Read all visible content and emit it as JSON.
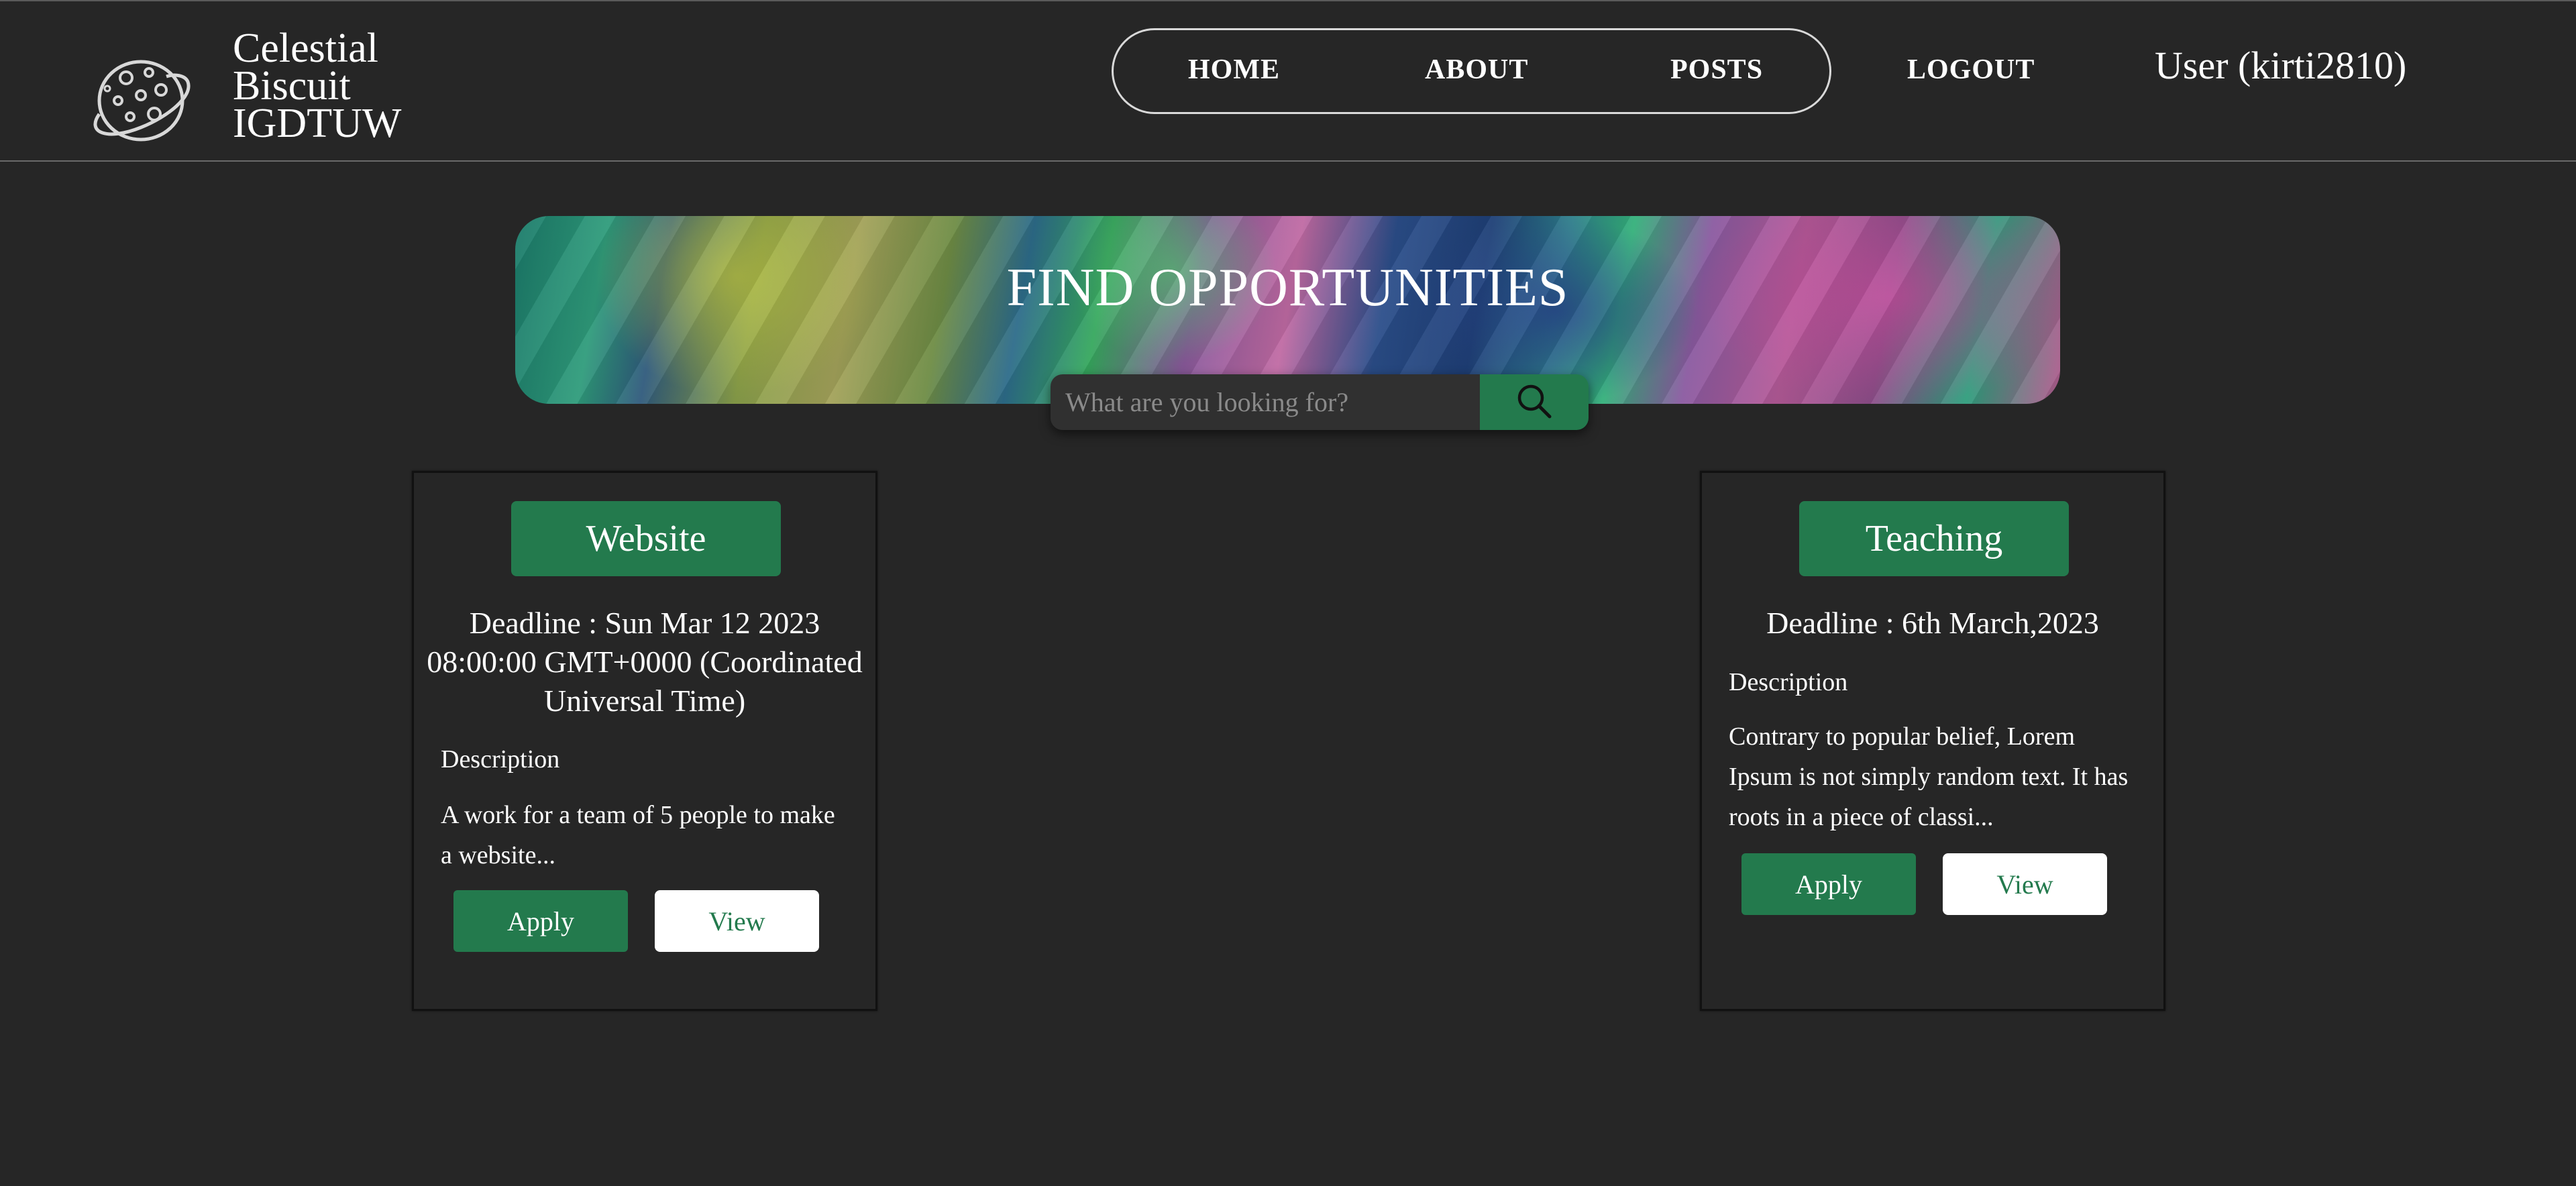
{
  "header": {
    "brand_lines": [
      "Celestial",
      "Biscuit",
      "IGDTUW"
    ],
    "logo_icon": "planet-icon",
    "nav": {
      "home": "HOME",
      "about": "ABOUT",
      "posts": "POSTS",
      "logout": "LOGOUT"
    },
    "user_label": "User (kirti2810)"
  },
  "hero": {
    "title": "FIND OPPORTUNITIES"
  },
  "search": {
    "placeholder": "What are you looking for?",
    "value": "",
    "button_icon": "search-icon"
  },
  "cards": [
    {
      "tag": "Website",
      "deadline": "Deadline : Sun Mar 12 2023 08:00:00 GMT+0000 (Coordinated Universal Time)",
      "description_label": "Description",
      "description": "A work for a team of 5 people to make a website...",
      "apply_label": "Apply",
      "view_label": "View"
    },
    {
      "tag": "Teaching",
      "deadline": "Deadline : 6th March,2023",
      "description_label": "Description",
      "description": "Contrary to popular belief, Lorem Ipsum is not simply random text. It has roots in a piece of classi...",
      "apply_label": "Apply",
      "view_label": "View"
    }
  ],
  "colors": {
    "background": "#262626",
    "accent_green": "#237a4d",
    "text": "#ffffff"
  }
}
